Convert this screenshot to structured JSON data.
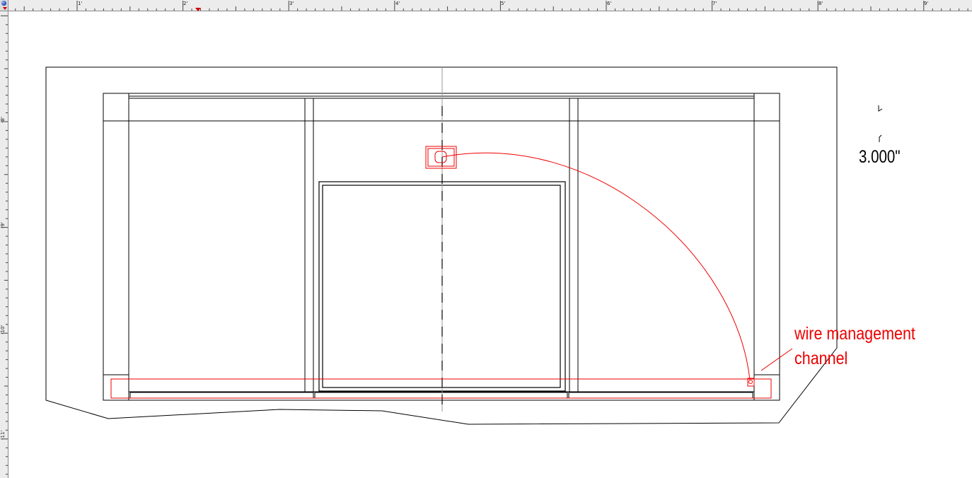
{
  "top_ruler": {
    "labels": [
      "1'",
      "2'",
      "3'",
      "4'",
      "5'",
      "6'",
      "7'",
      "8'",
      "9'"
    ]
  },
  "left_ruler": {
    "labels": [
      "-8'",
      "-9'",
      "-10'",
      "-11'"
    ]
  },
  "drawing": {
    "dimension_label": "3.000\"",
    "annotation": {
      "line1": "wire management",
      "line2": "channel",
      "color": "#ee0000"
    },
    "line_color": "#000000",
    "highlight_color": "#ee0000"
  }
}
